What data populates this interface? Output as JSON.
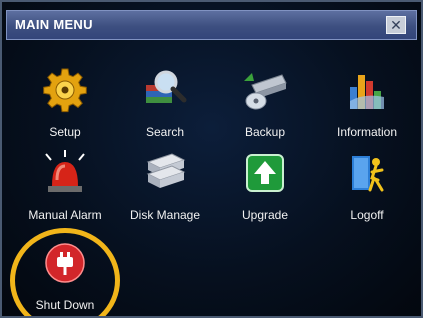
{
  "window": {
    "title": "MAIN MENU",
    "close_glyph": "✕"
  },
  "menu": {
    "items": [
      {
        "label": "Setup",
        "icon": "gear-icon"
      },
      {
        "label": "Search",
        "icon": "search-icon"
      },
      {
        "label": "Backup",
        "icon": "backup-icon"
      },
      {
        "label": "Information",
        "icon": "bar-chart-icon"
      },
      {
        "label": "Manual Alarm",
        "icon": "alarm-siren-icon"
      },
      {
        "label": "Disk Manage",
        "icon": "hard-disk-icon"
      },
      {
        "label": "Upgrade",
        "icon": "upgrade-arrow-icon"
      },
      {
        "label": "Logoff",
        "icon": "logoff-icon"
      },
      {
        "label": "Shut Down",
        "icon": "power-plug-icon"
      }
    ]
  },
  "highlight": {
    "color": "#f1b51a"
  }
}
